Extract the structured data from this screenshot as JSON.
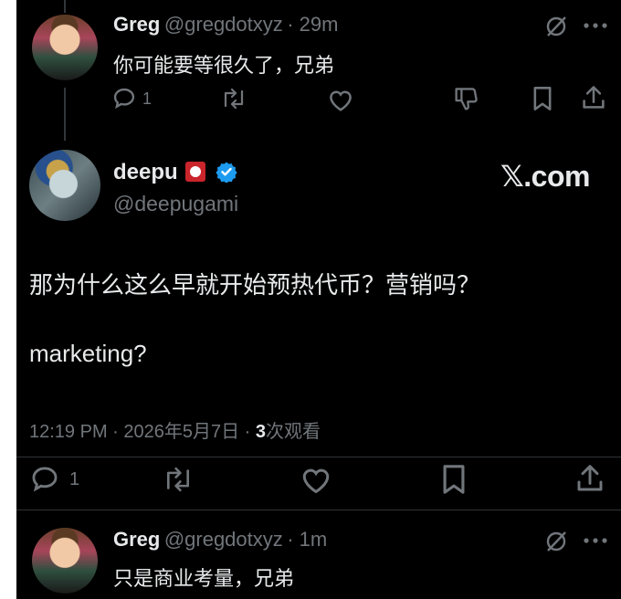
{
  "colors": {
    "background": "#000000",
    "text": "#e7e9ea",
    "muted": "#71767b",
    "verified": "#1d9bf0"
  },
  "reply_top": {
    "name": "Greg",
    "handle": "@gregdotxyz",
    "time": "· 29m",
    "text": "你可能要等很久了，兄弟",
    "reply_count": "1"
  },
  "main_tweet": {
    "name": "deepu",
    "handle": "@deepugami",
    "brand": "𝕏.com",
    "text_line1": "那为什么这么早就开始预热代币？营销吗？",
    "text_line2": "marketing?",
    "timestamp": "12:19 PM · 2026年5月7日 · ",
    "views_count": "3",
    "views_label": "次观看",
    "reply_count": "1"
  },
  "reply_bottom": {
    "name": "Greg",
    "handle": "@gregdotxyz",
    "time": "· 1m",
    "text": "只是商业考量，兄弟"
  }
}
